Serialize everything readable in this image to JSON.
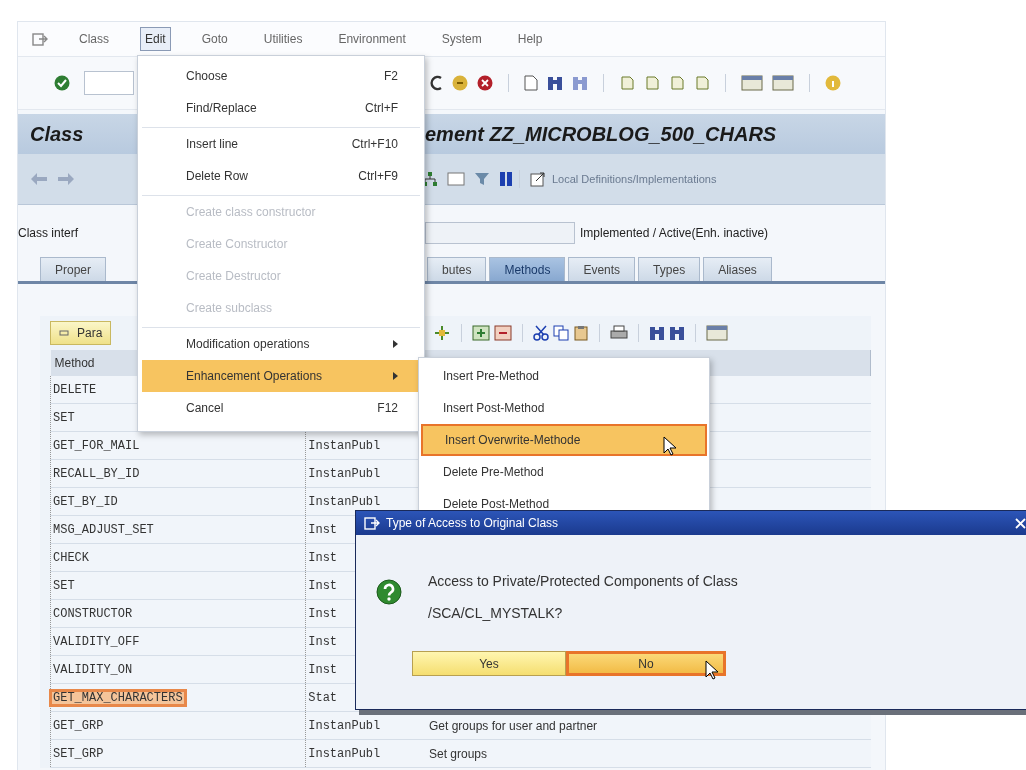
{
  "menu_bar": {
    "items": [
      {
        "label": "Class",
        "selected": false
      },
      {
        "label": "Edit",
        "selected": true
      },
      {
        "label": "Goto",
        "selected": false
      },
      {
        "label": "Utilities",
        "selected": false
      },
      {
        "label": "Environment",
        "selected": false
      },
      {
        "label": "System",
        "selected": false
      },
      {
        "label": "Help",
        "selected": false
      }
    ]
  },
  "title": {
    "left": "Class",
    "right": "ement ZZ_MICROBLOG_500_CHARS"
  },
  "app_toolbar": {
    "button": "Local Definitions/Implementations"
  },
  "class_interface": {
    "label": "Class interf",
    "status": "Implemented / Active(Enh. inactive)"
  },
  "tabs": [
    {
      "label": "Proper",
      "selected": false
    },
    {
      "label": "butes",
      "selected": false
    },
    {
      "label": "Methods",
      "selected": true
    },
    {
      "label": "Events",
      "selected": false
    },
    {
      "label": "Types",
      "selected": false
    },
    {
      "label": "Aliases",
      "selected": false
    }
  ],
  "table_toolbar": {
    "button": "Para"
  },
  "table": {
    "columns": [
      "Method"
    ],
    "rows": [
      {
        "method": "DELETE",
        "selected": false
      },
      {
        "method": "SET",
        "selected": false
      },
      {
        "method": "GET_FOR_MAIL",
        "type": "InstanPubl",
        "selected": false
      },
      {
        "method": "RECALL_BY_ID",
        "type": "InstanPubl",
        "selected": false
      },
      {
        "method": "GET_BY_ID",
        "type": "InstanPubl",
        "selected": false
      },
      {
        "method": "MSG_ADJUST_SET",
        "type": "Inst",
        "selected": false
      },
      {
        "method": "CHECK",
        "type": "Inst",
        "selected": false
      },
      {
        "method": "SET",
        "type": "Inst",
        "selected": false
      },
      {
        "method": "CONSTRUCTOR",
        "type": "Inst",
        "selected": false
      },
      {
        "method": "VALIDITY_OFF",
        "type": "Inst",
        "selected": false
      },
      {
        "method": "VALIDITY_ON",
        "type": "Inst",
        "selected": false
      },
      {
        "method": "GET_MAX_CHARACTERS",
        "type": "Stat",
        "selected": true
      },
      {
        "method": "GET_GRP",
        "type": "InstanPubl",
        "description": "Get groups for user and partner",
        "selected": false
      },
      {
        "method": "SET_GRP",
        "type": "InstanPubl",
        "description": "Set groups",
        "selected": false
      }
    ]
  },
  "edit_menu": {
    "items": [
      {
        "label": "Choose",
        "shortcut": "F2",
        "disabled": false,
        "selected": false,
        "separator_before": false,
        "submenu": false
      },
      {
        "label": "Find/Replace",
        "shortcut": "Ctrl+F",
        "disabled": false,
        "selected": false,
        "separator_before": false,
        "submenu": false
      },
      {
        "label": "Insert line",
        "shortcut": "Ctrl+F10",
        "disabled": false,
        "selected": false,
        "separator_before": true,
        "submenu": false
      },
      {
        "label": "Delete Row",
        "shortcut": "Ctrl+F9",
        "disabled": false,
        "selected": false,
        "separator_before": false,
        "submenu": false
      },
      {
        "label": "Create class constructor",
        "disabled": true,
        "selected": false,
        "separator_before": true,
        "submenu": false
      },
      {
        "label": "Create Constructor",
        "disabled": true,
        "selected": false,
        "separator_before": false,
        "submenu": false
      },
      {
        "label": "Create Destructor",
        "disabled": true,
        "selected": false,
        "separator_before": false,
        "submenu": false
      },
      {
        "label": "Create subclass",
        "disabled": true,
        "selected": false,
        "separator_before": false,
        "submenu": false
      },
      {
        "label": "Modification operations",
        "disabled": false,
        "selected": false,
        "separator_before": true,
        "submenu": true
      },
      {
        "label": "Enhancement Operations",
        "disabled": false,
        "selected": true,
        "separator_before": false,
        "submenu": true
      },
      {
        "label": "Cancel",
        "shortcut": "F12",
        "disabled": false,
        "selected": false,
        "separator_before": false,
        "submenu": false
      }
    ]
  },
  "submenu": {
    "items": [
      {
        "label": "Insert Pre-Method",
        "selected": false
      },
      {
        "label": "Insert Post-Method",
        "selected": false
      },
      {
        "label": "Insert Overwrite-Methode",
        "selected": true
      },
      {
        "label": "Delete Pre-Method",
        "selected": false
      },
      {
        "label": "Delete Post-Method",
        "selected": false
      }
    ]
  },
  "dialog": {
    "title": "Type of Access to Original Class",
    "message": "Access to Private/Protected Components of Class\n/SCA/CL_MYSTALK?",
    "buttons": [
      {
        "label": "Yes",
        "selected": false
      },
      {
        "label": "No",
        "selected": true
      }
    ]
  }
}
